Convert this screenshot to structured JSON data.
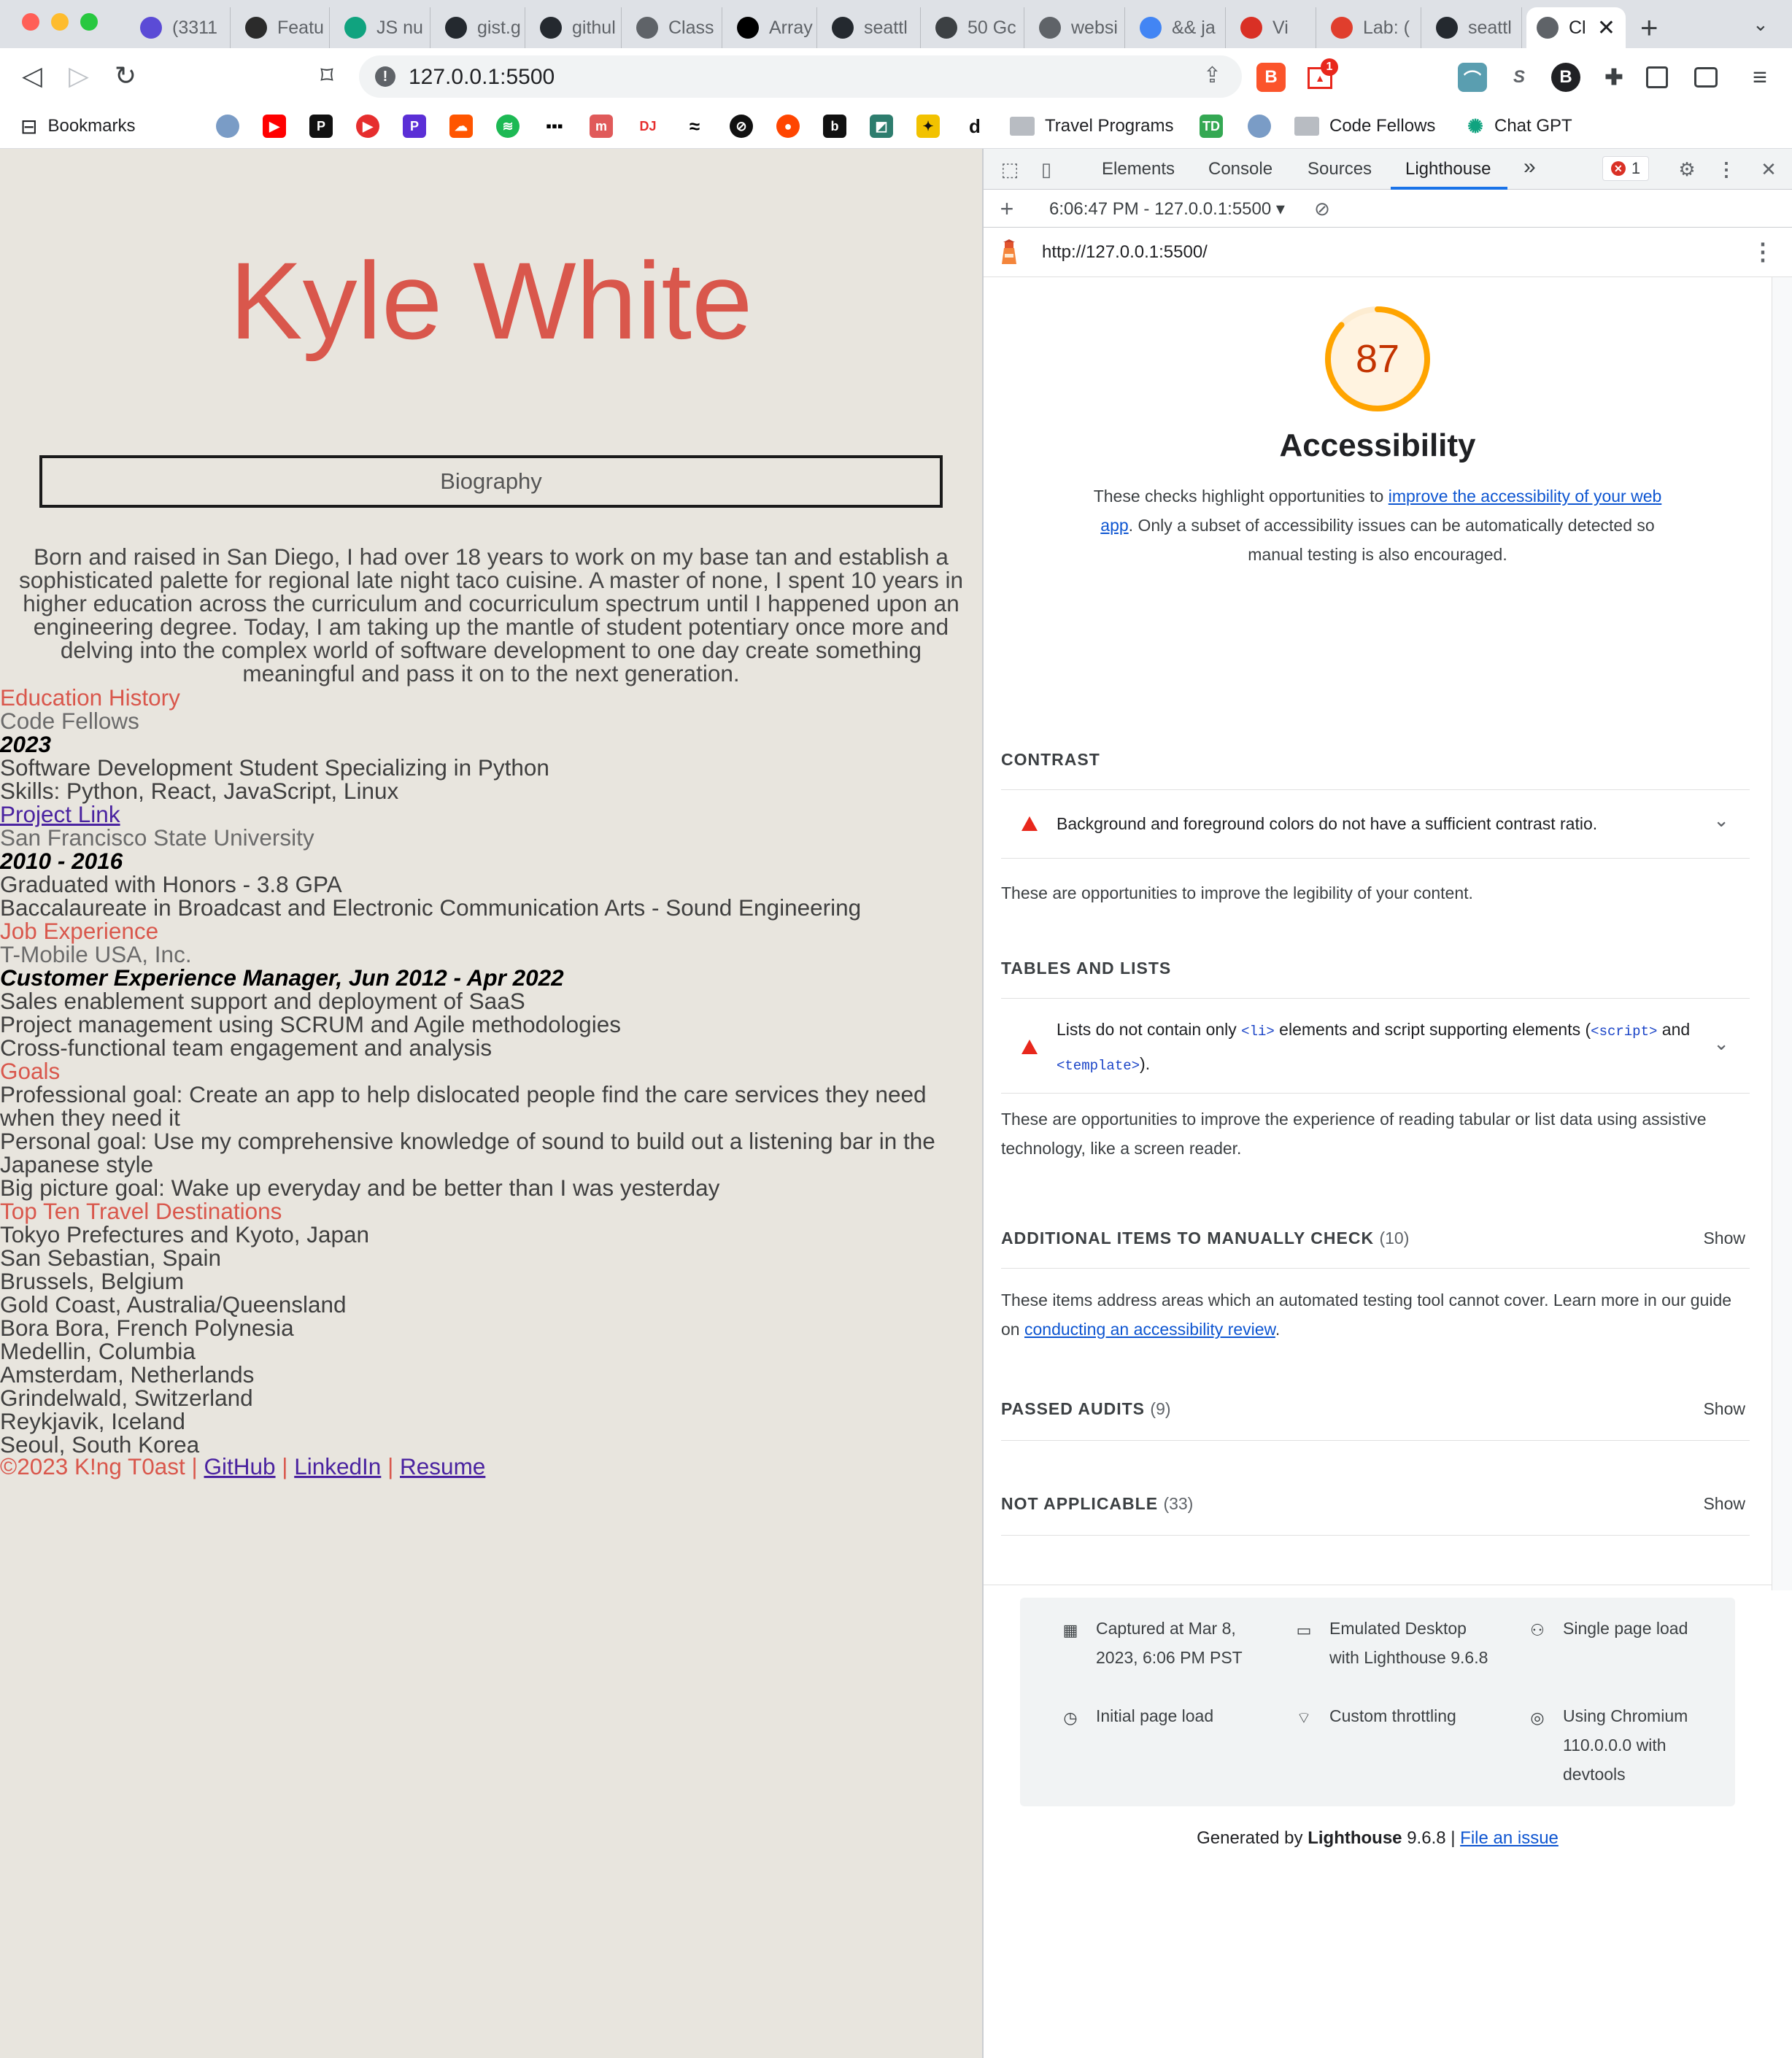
{
  "browser": {
    "tabs": [
      {
        "label": "(3311",
        "icon": "mail-icon",
        "color": "#5b4bd6"
      },
      {
        "label": "Featu",
        "icon": "terminal-icon",
        "color": "#2b2b2b"
      },
      {
        "label": "JS nu",
        "icon": "chatgpt-icon",
        "color": "#10a37f"
      },
      {
        "label": "gist.g",
        "icon": "github-icon",
        "color": "#24292f"
      },
      {
        "label": "githul",
        "icon": "github-icon",
        "color": "#24292f"
      },
      {
        "label": "Class",
        "icon": "globe-icon",
        "color": "#5f6368"
      },
      {
        "label": "Array",
        "icon": "medium-icon",
        "color": "#000000"
      },
      {
        "label": "seattl",
        "icon": "github-icon",
        "color": "#24292f"
      },
      {
        "label": "50 Gc",
        "icon": "cloud-icon",
        "color": "#3c4043"
      },
      {
        "label": "websi",
        "icon": "globe-icon",
        "color": "#5f6368"
      },
      {
        "label": "&& ja",
        "icon": "google-icon",
        "color": "#4285f4"
      },
      {
        "label": "Vi",
        "icon": "record-icon",
        "color": "#d93025"
      },
      {
        "label": "Lab: (",
        "icon": "canvas-icon",
        "color": "#e03e2d"
      },
      {
        "label": "seattl",
        "icon": "github-icon",
        "color": "#24292f"
      },
      {
        "label": "Cl",
        "icon": "globe-icon",
        "color": "#5f6368",
        "active": true
      }
    ],
    "new_tab": "+",
    "url": "127.0.0.1:5500",
    "bookmarks_label": "Bookmarks",
    "bookmark_folders": [
      "Travel Programs",
      "Code Fellows"
    ],
    "chatgpt_bookmark": "Chat GPT",
    "brave_badge": "1"
  },
  "page": {
    "title": "Kyle White",
    "bio_heading": "Biography",
    "bio": "Born and raised in San Diego, I had over 18 years to work on my base tan and establish a sophisticated palette for regional late night taco cuisine. A master of none, I spent 10 years in higher education across the curriculum and cocurriculum spectrum until I happened upon an engineering degree. Today, I am taking up the mantle of student potentiary once more and delving into the complex world of software development to one day create something meaningful and pass it on to the next generation.",
    "lines": [
      {
        "text": "Education History",
        "kind": "sec"
      },
      {
        "text": "Code Fellows",
        "kind": "org"
      },
      {
        "text": "2023",
        "kind": "date"
      },
      {
        "text": "Software Development Student Specializing in Python",
        "kind": "plain"
      },
      {
        "text": "Skills: Python, React, JavaScript, Linux",
        "kind": "plain"
      },
      {
        "text": "Project Link",
        "kind": "plink"
      },
      {
        "text": "San Francisco State University",
        "kind": "org"
      },
      {
        "text": "2010 - 2016",
        "kind": "date"
      },
      {
        "text": "Graduated with Honors - 3.8 GPA",
        "kind": "plain"
      },
      {
        "text": "Baccalaureate in Broadcast and Electronic Communication Arts - Sound Engineering",
        "kind": "plain"
      },
      {
        "text": "Job Experience",
        "kind": "sec"
      },
      {
        "text": "T-Mobile USA, Inc.",
        "kind": "org"
      },
      {
        "text": "Customer Experience Manager, Jun 2012 - Apr 2022",
        "kind": "date"
      },
      {
        "text": "Sales enablement support and deployment of SaaS",
        "kind": "plain"
      },
      {
        "text": "Project management using SCRUM and Agile methodologies",
        "kind": "plain"
      },
      {
        "text": "Cross-functional team engagement and analysis",
        "kind": "plain"
      },
      {
        "text": "Goals",
        "kind": "sec"
      },
      {
        "text": "Professional goal: Create an app to help dislocated people find the care services they need",
        "kind": "plain"
      },
      {
        "text": "when they need it",
        "kind": "plain"
      },
      {
        "text": "Personal goal: Use my comprehensive knowledge of sound to build out a listening bar in the",
        "kind": "plain"
      },
      {
        "text": "Japanese style",
        "kind": "plain"
      },
      {
        "text": "Big picture goal: Wake up everyday and be better than I was yesterday",
        "kind": "plain"
      },
      {
        "text": "Top Ten Travel Destinations",
        "kind": "sec"
      },
      {
        "text": "Tokyo Prefectures and Kyoto, Japan",
        "kind": "plain"
      },
      {
        "text": "San Sebastian, Spain",
        "kind": "plain"
      },
      {
        "text": "Brussels, Belgium",
        "kind": "plain"
      },
      {
        "text": "Gold Coast, Australia/Queensland",
        "kind": "plain"
      },
      {
        "text": "Bora Bora, French Polynesia",
        "kind": "plain"
      },
      {
        "text": "Medellin, Columbia",
        "kind": "plain"
      },
      {
        "text": "Amsterdam, Netherlands",
        "kind": "plain"
      },
      {
        "text": "Grindelwald, Switzerland",
        "kind": "plain"
      },
      {
        "text": "Reykjavik, Iceland",
        "kind": "plain"
      },
      {
        "text": "Seoul, South Korea",
        "kind": "plain"
      }
    ],
    "footer": {
      "copyright": "©2023 K!ng T0ast | ",
      "github": "GitHub",
      "sep1": " | ",
      "linkedin": "LinkedIn",
      "sep2": " | ",
      "resume": "Resume"
    }
  },
  "devtools": {
    "tabs": [
      "Elements",
      "Console",
      "Sources",
      "Lighthouse"
    ],
    "active_tab": "Lighthouse",
    "more": "»",
    "error_count": "1",
    "report_selector": "6:06:47 PM - 127.0.0.1:5500 ▾",
    "report_url": "http://127.0.0.1:5500/",
    "lighthouse": {
      "score": 87,
      "score_color": "#ffa400",
      "category_title": "Accessibility",
      "desc_before": "These checks highlight opportunities to ",
      "desc_link": "improve the accessibility of your web app",
      "desc_after": ". Only a subset of accessibility issues can be automatically detected so manual testing is also encouraged.",
      "contrast": {
        "title": "CONTRAST",
        "audit": "Background and foreground colors do not have a sufficient contrast ratio.",
        "desc": "These are opportunities to improve the legibility of your content."
      },
      "tables": {
        "title": "TABLES AND LISTS",
        "audit_a": "Lists do not contain only ",
        "code_li": "<li>",
        "audit_b": " elements and script supporting elements (",
        "code_script": "<script>",
        "audit_c": " and ",
        "code_template": "<template>",
        "audit_d": ").",
        "desc": "These are opportunities to improve the experience of reading tabular or list data using assistive technology, like a screen reader."
      },
      "manual": {
        "title": "ADDITIONAL ITEMS TO MANUALLY CHECK",
        "count": "(10)",
        "show": "Show",
        "desc_before": "These items address areas which an automated testing tool cannot cover. Learn more in our guide on ",
        "desc_link": "conducting an accessibility review",
        "desc_after": "."
      },
      "passed": {
        "title": "PASSED AUDITS",
        "count": "(9)",
        "show": "Show"
      },
      "na": {
        "title": "NOT APPLICABLE",
        "count": "(33)",
        "show": "Show"
      },
      "env": {
        "captured": "Captured at Mar 8, 2023, 6:06 PM PST",
        "device": "Emulated Desktop with Lighthouse 9.6.8",
        "single": "Single page load",
        "initial": "Initial page load",
        "throttling": "Custom throttling",
        "chromium": "Using Chromium 110.0.0.0 with devtools"
      },
      "footer": {
        "generated": "Generated by ",
        "lighthouse": "Lighthouse",
        "version": " 9.6.8 | ",
        "issue": "File an issue"
      }
    }
  }
}
